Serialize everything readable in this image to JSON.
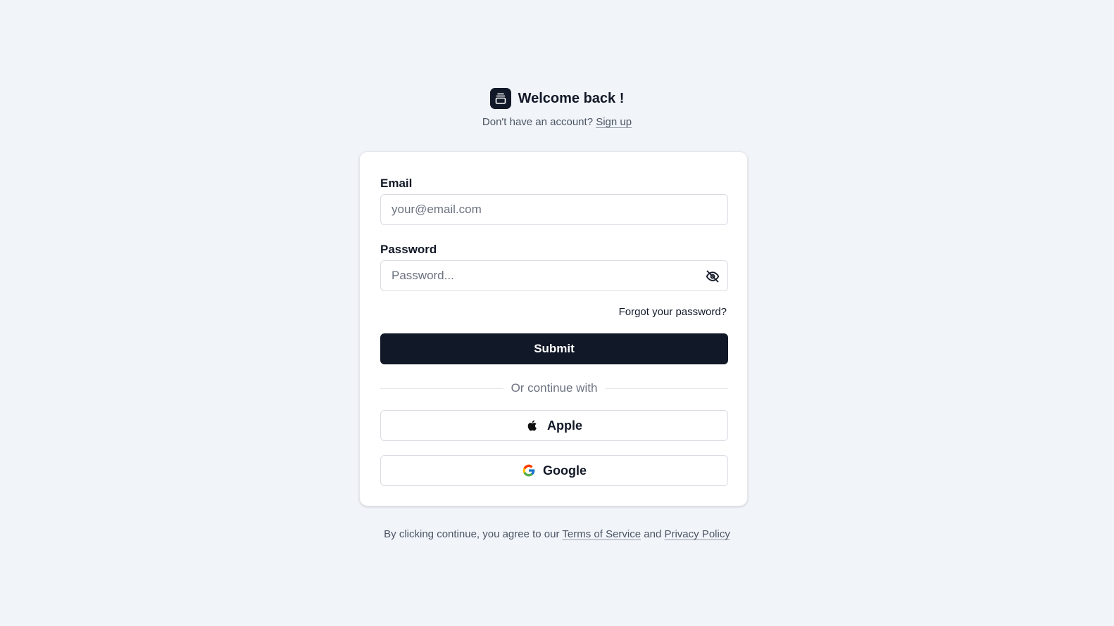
{
  "header": {
    "title": "Welcome back !",
    "subtitle_prefix": "Don't have an account?",
    "signup_link": "Sign up"
  },
  "form": {
    "email_label": "Email",
    "email_placeholder": "your@email.com",
    "email_value": "",
    "password_label": "Password",
    "password_placeholder": "Password...",
    "password_value": "",
    "password_toggle_icon": "eye-off-icon",
    "forgot_link": "Forgot your password?",
    "submit_label": "Submit",
    "divider_text": "Or continue with",
    "apple_label": "Apple",
    "google_label": "Google"
  },
  "legal": {
    "prefix": "By clicking continue, you agree to our",
    "terms_link": "Terms of Service",
    "conjunction": "and",
    "privacy_link": "Privacy Policy"
  },
  "colors": {
    "page_background": "#f1f4f9",
    "primary_button": "#111827",
    "card_background": "#ffffff",
    "muted_text": "#6b7280"
  }
}
